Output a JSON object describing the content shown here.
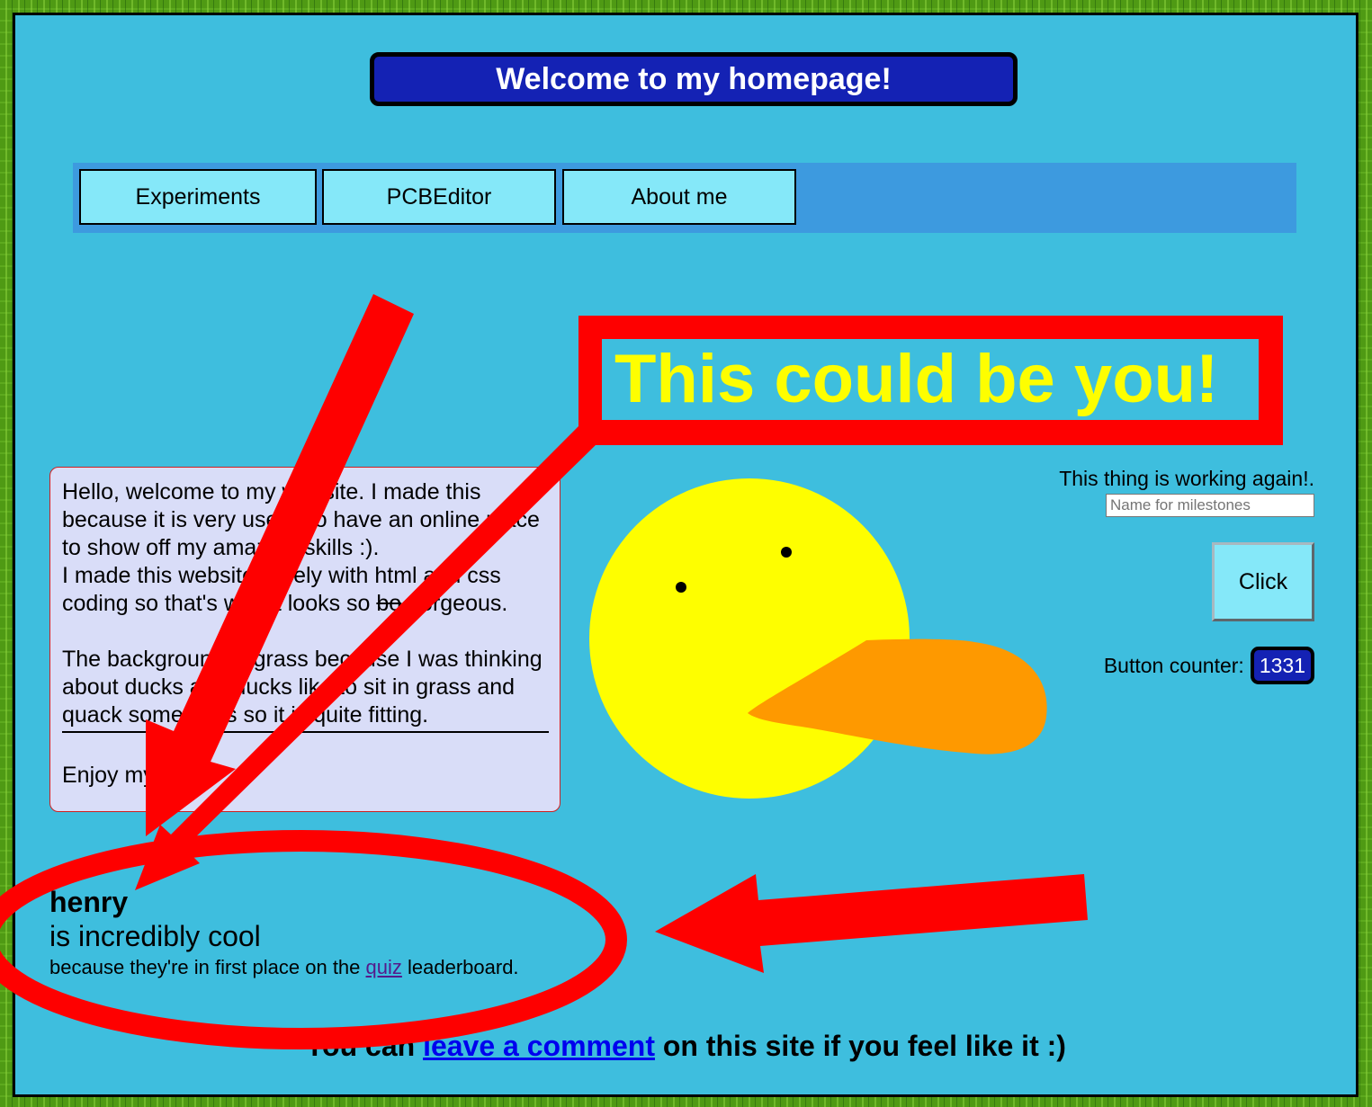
{
  "header": {
    "title": "Welcome to my homepage!"
  },
  "nav": {
    "items": [
      {
        "label": "Experiments"
      },
      {
        "label": "PCBEditor"
      },
      {
        "label": "About me"
      }
    ]
  },
  "headline": "This could be you!",
  "intro": {
    "line1": "Hello, welcome to my website. I made this because it is very useful to have an online place to show off my amazing skills :).",
    "line2_before": "I made this website purely with html and css coding so that's why it looks so ",
    "line2_struck": "bo",
    "line2_after": " gorgeous.",
    "para2": "The background is grass because I was thinking about ducks and ducks like to sit in grass and quack sometimes so it is quite fitting.",
    "closing": "Enjoy my site :)"
  },
  "widget": {
    "status_text": "This thing is working again!.",
    "milestone_placeholder": "Name for milestones",
    "click_label": "Click",
    "counter_label": "Button counter:",
    "counter_value": "1331"
  },
  "leader": {
    "name": "henry",
    "tagline": "is incredibly cool",
    "reason_before": "because they're in first place on the ",
    "reason_link": "quiz",
    "reason_after": " leaderboard."
  },
  "comment": {
    "before": "You can ",
    "link": "leave a comment",
    "after": " on this site if you feel like it :)"
  },
  "colors": {
    "page_background": "#3ebede",
    "grass": "#4f9a14",
    "banner": "#1422b4",
    "nav_bar": "#3d9adf",
    "nav_button": "#85e8f9",
    "highlight_red": "#fe0000",
    "headline_yellow": "#fefe00",
    "duck_body": "#fefe00",
    "duck_beak": "#fe9900"
  }
}
